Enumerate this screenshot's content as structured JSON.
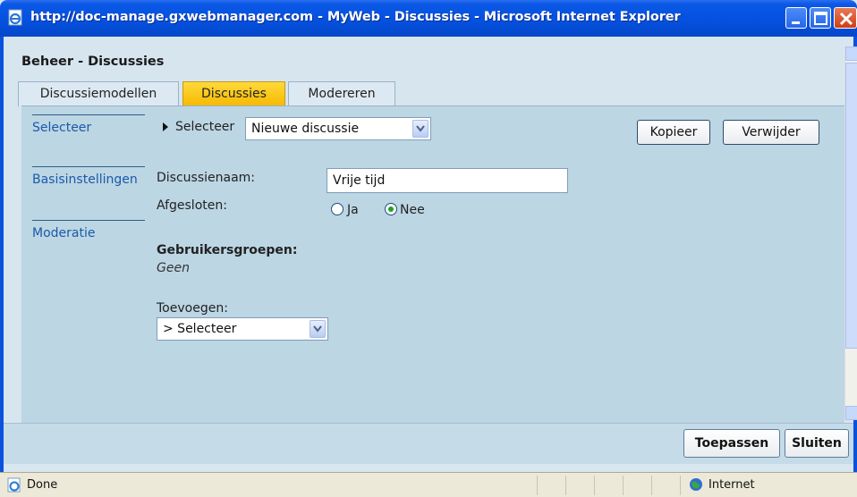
{
  "window": {
    "title": "http://doc-manage.gxwebmanager.com - MyWeb - Discussies - Microsoft Internet Explorer"
  },
  "page": {
    "heading": "Beheer - Discussies"
  },
  "tabs": [
    {
      "label": "Discussiemodellen",
      "active": false
    },
    {
      "label": "Discussies",
      "active": true
    },
    {
      "label": "Modereren",
      "active": false
    }
  ],
  "sidenav": [
    {
      "label": "Selecteer"
    },
    {
      "label": "Basisinstellingen"
    },
    {
      "label": "Moderatie"
    }
  ],
  "select_row": {
    "label": "Selecteer",
    "selected_value": "Nieuwe discussie",
    "copy_label": "Kopieer",
    "delete_label": "Verwijder"
  },
  "form": {
    "name_label": "Discussienaam:",
    "name_value": "Vrije tijd",
    "closed_label": "Afgesloten:",
    "radio_yes": "Ja",
    "radio_no": "Nee",
    "closed_selected": "Nee",
    "groups_heading": "Gebruikersgroepen:",
    "groups_value": "Geen",
    "add_label": "Toevoegen:",
    "add_selected": "> Selecteer"
  },
  "footer": {
    "apply_label": "Toepassen",
    "close_label": "Sluiten"
  },
  "statusbar": {
    "status": "Done",
    "zone": "Internet"
  },
  "colors": {
    "titlebar": "#0550de",
    "active_tab": "#f6b800",
    "panel": "#bcd6e4",
    "nav_link": "#1b5aa8"
  },
  "icons": [
    "ie-page-icon",
    "minimize-icon",
    "maximize-icon",
    "close-icon",
    "dropdown-arrow-icon",
    "triangle-right-icon",
    "globe-icon"
  ]
}
